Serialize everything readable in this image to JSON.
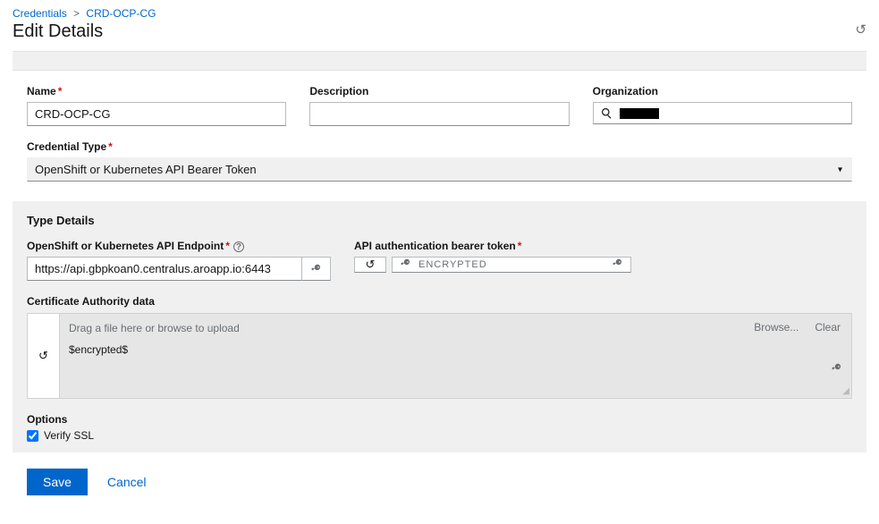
{
  "breadcrumb": {
    "root": "Credentials",
    "current": "CRD-OCP-CG"
  },
  "page_title": "Edit Details",
  "fields": {
    "name": {
      "label": "Name",
      "value": "CRD-OCP-CG"
    },
    "description": {
      "label": "Description",
      "value": ""
    },
    "organization": {
      "label": "Organization",
      "value": ""
    },
    "credential_type": {
      "label": "Credential Type",
      "value": "OpenShift or Kubernetes API Bearer Token"
    }
  },
  "type_details": {
    "heading": "Type Details",
    "endpoint": {
      "label": "OpenShift or Kubernetes API Endpoint",
      "value": "https://api.gbpkoan0.centralus.aroapp.io:6443"
    },
    "token": {
      "label": "API authentication bearer token",
      "status": "ENCRYPTED"
    },
    "ca": {
      "label": "Certificate Authority data",
      "drag_text": "Drag a file here or browse to upload",
      "value": "$encrypted$",
      "browse": "Browse...",
      "clear": "Clear"
    },
    "options": {
      "heading": "Options",
      "verify_ssl": {
        "label": "Verify SSL",
        "checked": true
      }
    }
  },
  "buttons": {
    "save": "Save",
    "cancel": "Cancel"
  }
}
